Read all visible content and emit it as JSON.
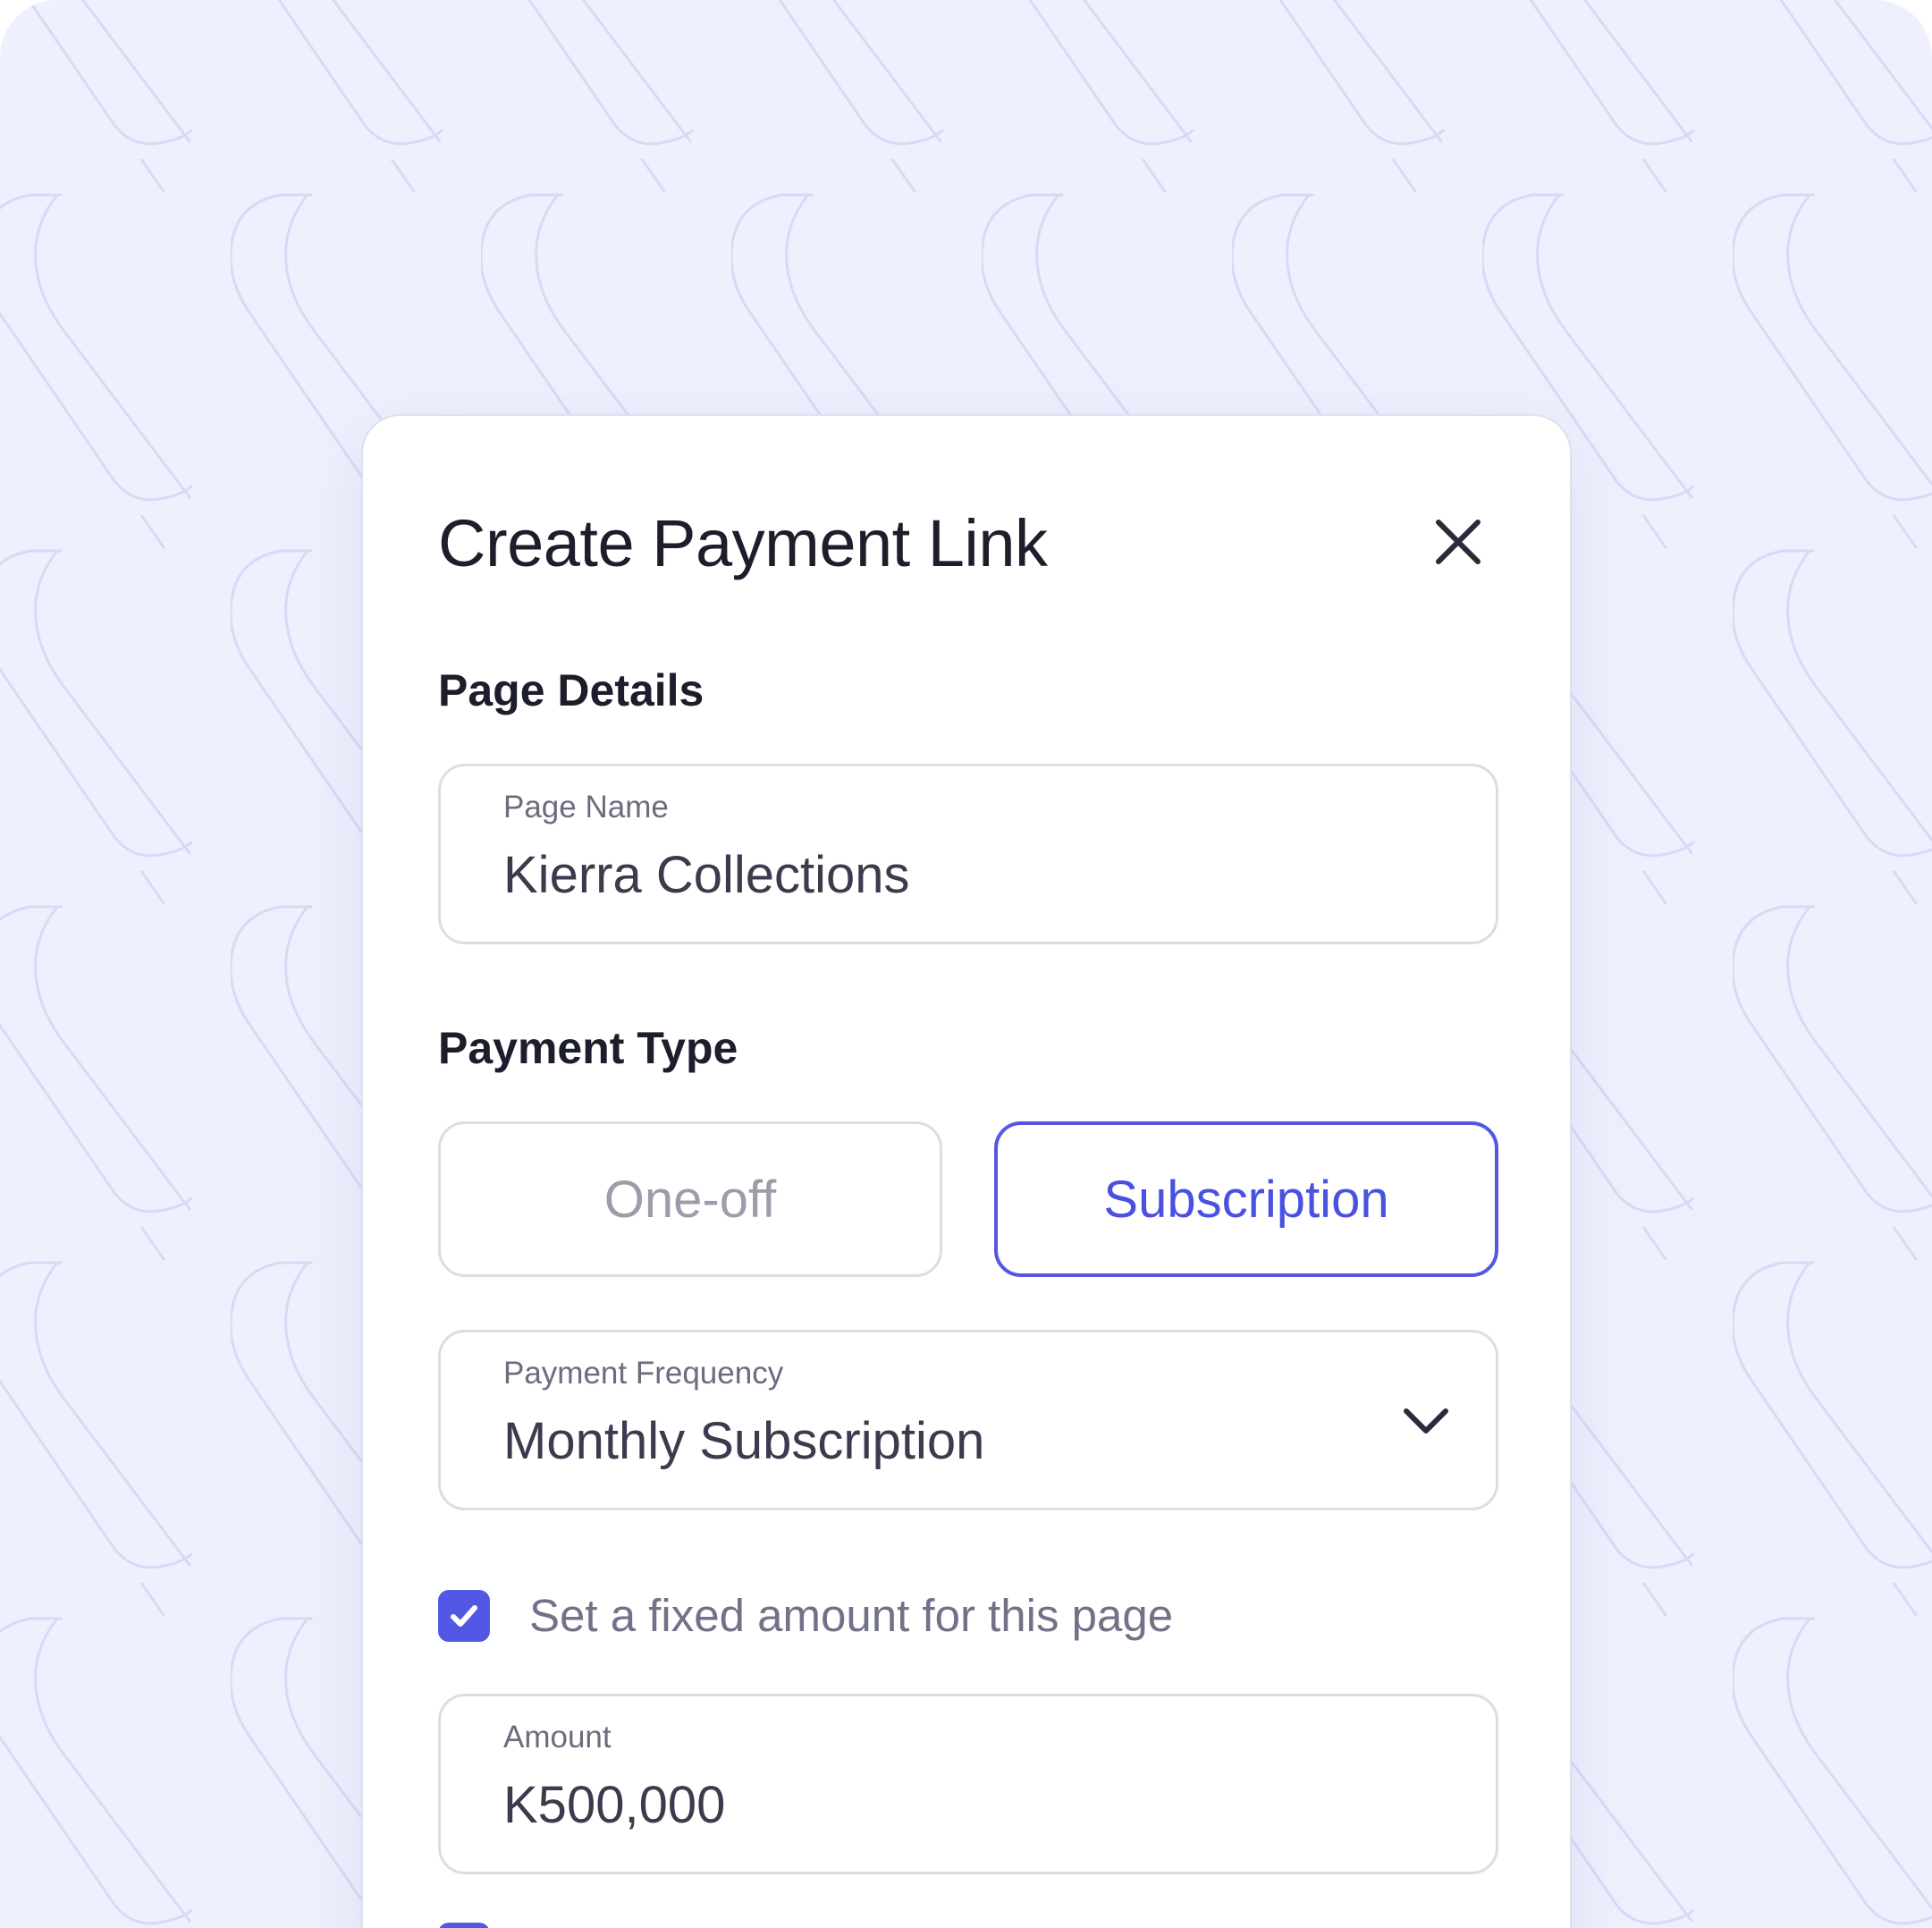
{
  "modal": {
    "title": "Create Payment Link",
    "close_icon": "close-icon"
  },
  "page_details": {
    "heading": "Page Details",
    "page_name_label": "Page Name",
    "page_name_value": "Kierra Collections"
  },
  "payment_type": {
    "heading": "Payment Type",
    "options": [
      "One-off",
      "Subscription"
    ],
    "selected": "Subscription",
    "frequency_label": "Payment Frequency",
    "frequency_value": "Monthly Subscription",
    "dropdown_icon": "chevron-down-icon"
  },
  "fixed_amount": {
    "checkbox_label": "Set a fixed amount for this page",
    "checked": true,
    "amount_label": "Amount",
    "amount_value": "K500,000"
  },
  "colors": {
    "accent": "#5258e4",
    "background": "#eef0fd",
    "text_primary": "#1d1e2c",
    "border": "#dcdde3"
  }
}
